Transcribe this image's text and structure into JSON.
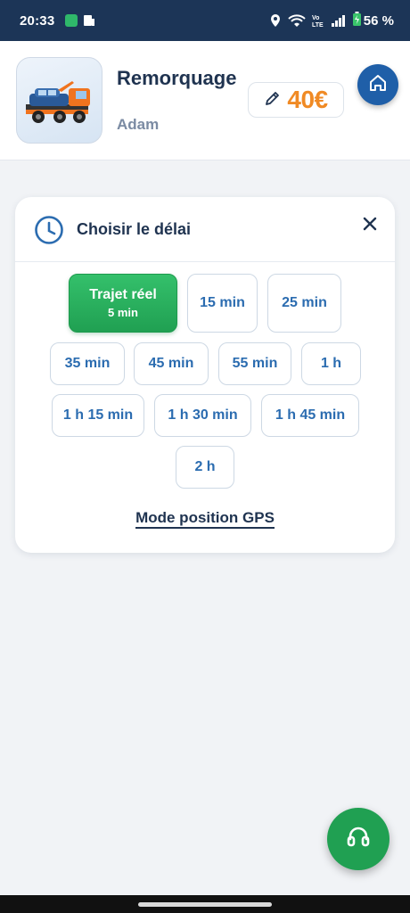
{
  "status_bar": {
    "time": "20:33",
    "battery": "56 %",
    "icons": [
      "app-icon",
      "sim-icon",
      "location-icon",
      "wifi-icon",
      "volte-icon",
      "signal-icon",
      "battery-icon"
    ]
  },
  "header": {
    "title": "Remorquage",
    "subtitle": "Adam",
    "price": "40€",
    "price_color": "#f08a24",
    "image_icon": "tow-truck-image",
    "home_icon": "home-icon",
    "edit_icon": "pencil-icon"
  },
  "delay_card": {
    "title": "Choisir le délai",
    "icon": "clock-icon",
    "close_icon": "close-icon",
    "selected": {
      "label": "Trajet réel",
      "sub": "5 min"
    },
    "options": [
      "15 min",
      "25 min",
      "35 min",
      "45 min",
      "55 min",
      "1 h",
      "1 h 15 min",
      "1 h 30 min",
      "1 h 45 min",
      "2 h"
    ],
    "gps_link": "Mode position GPS"
  },
  "colors": {
    "accent_blue": "#2b6cb0",
    "active_green": "#20a052",
    "header_dark": "#1c3557"
  },
  "fab": {
    "icon": "headset-icon"
  }
}
